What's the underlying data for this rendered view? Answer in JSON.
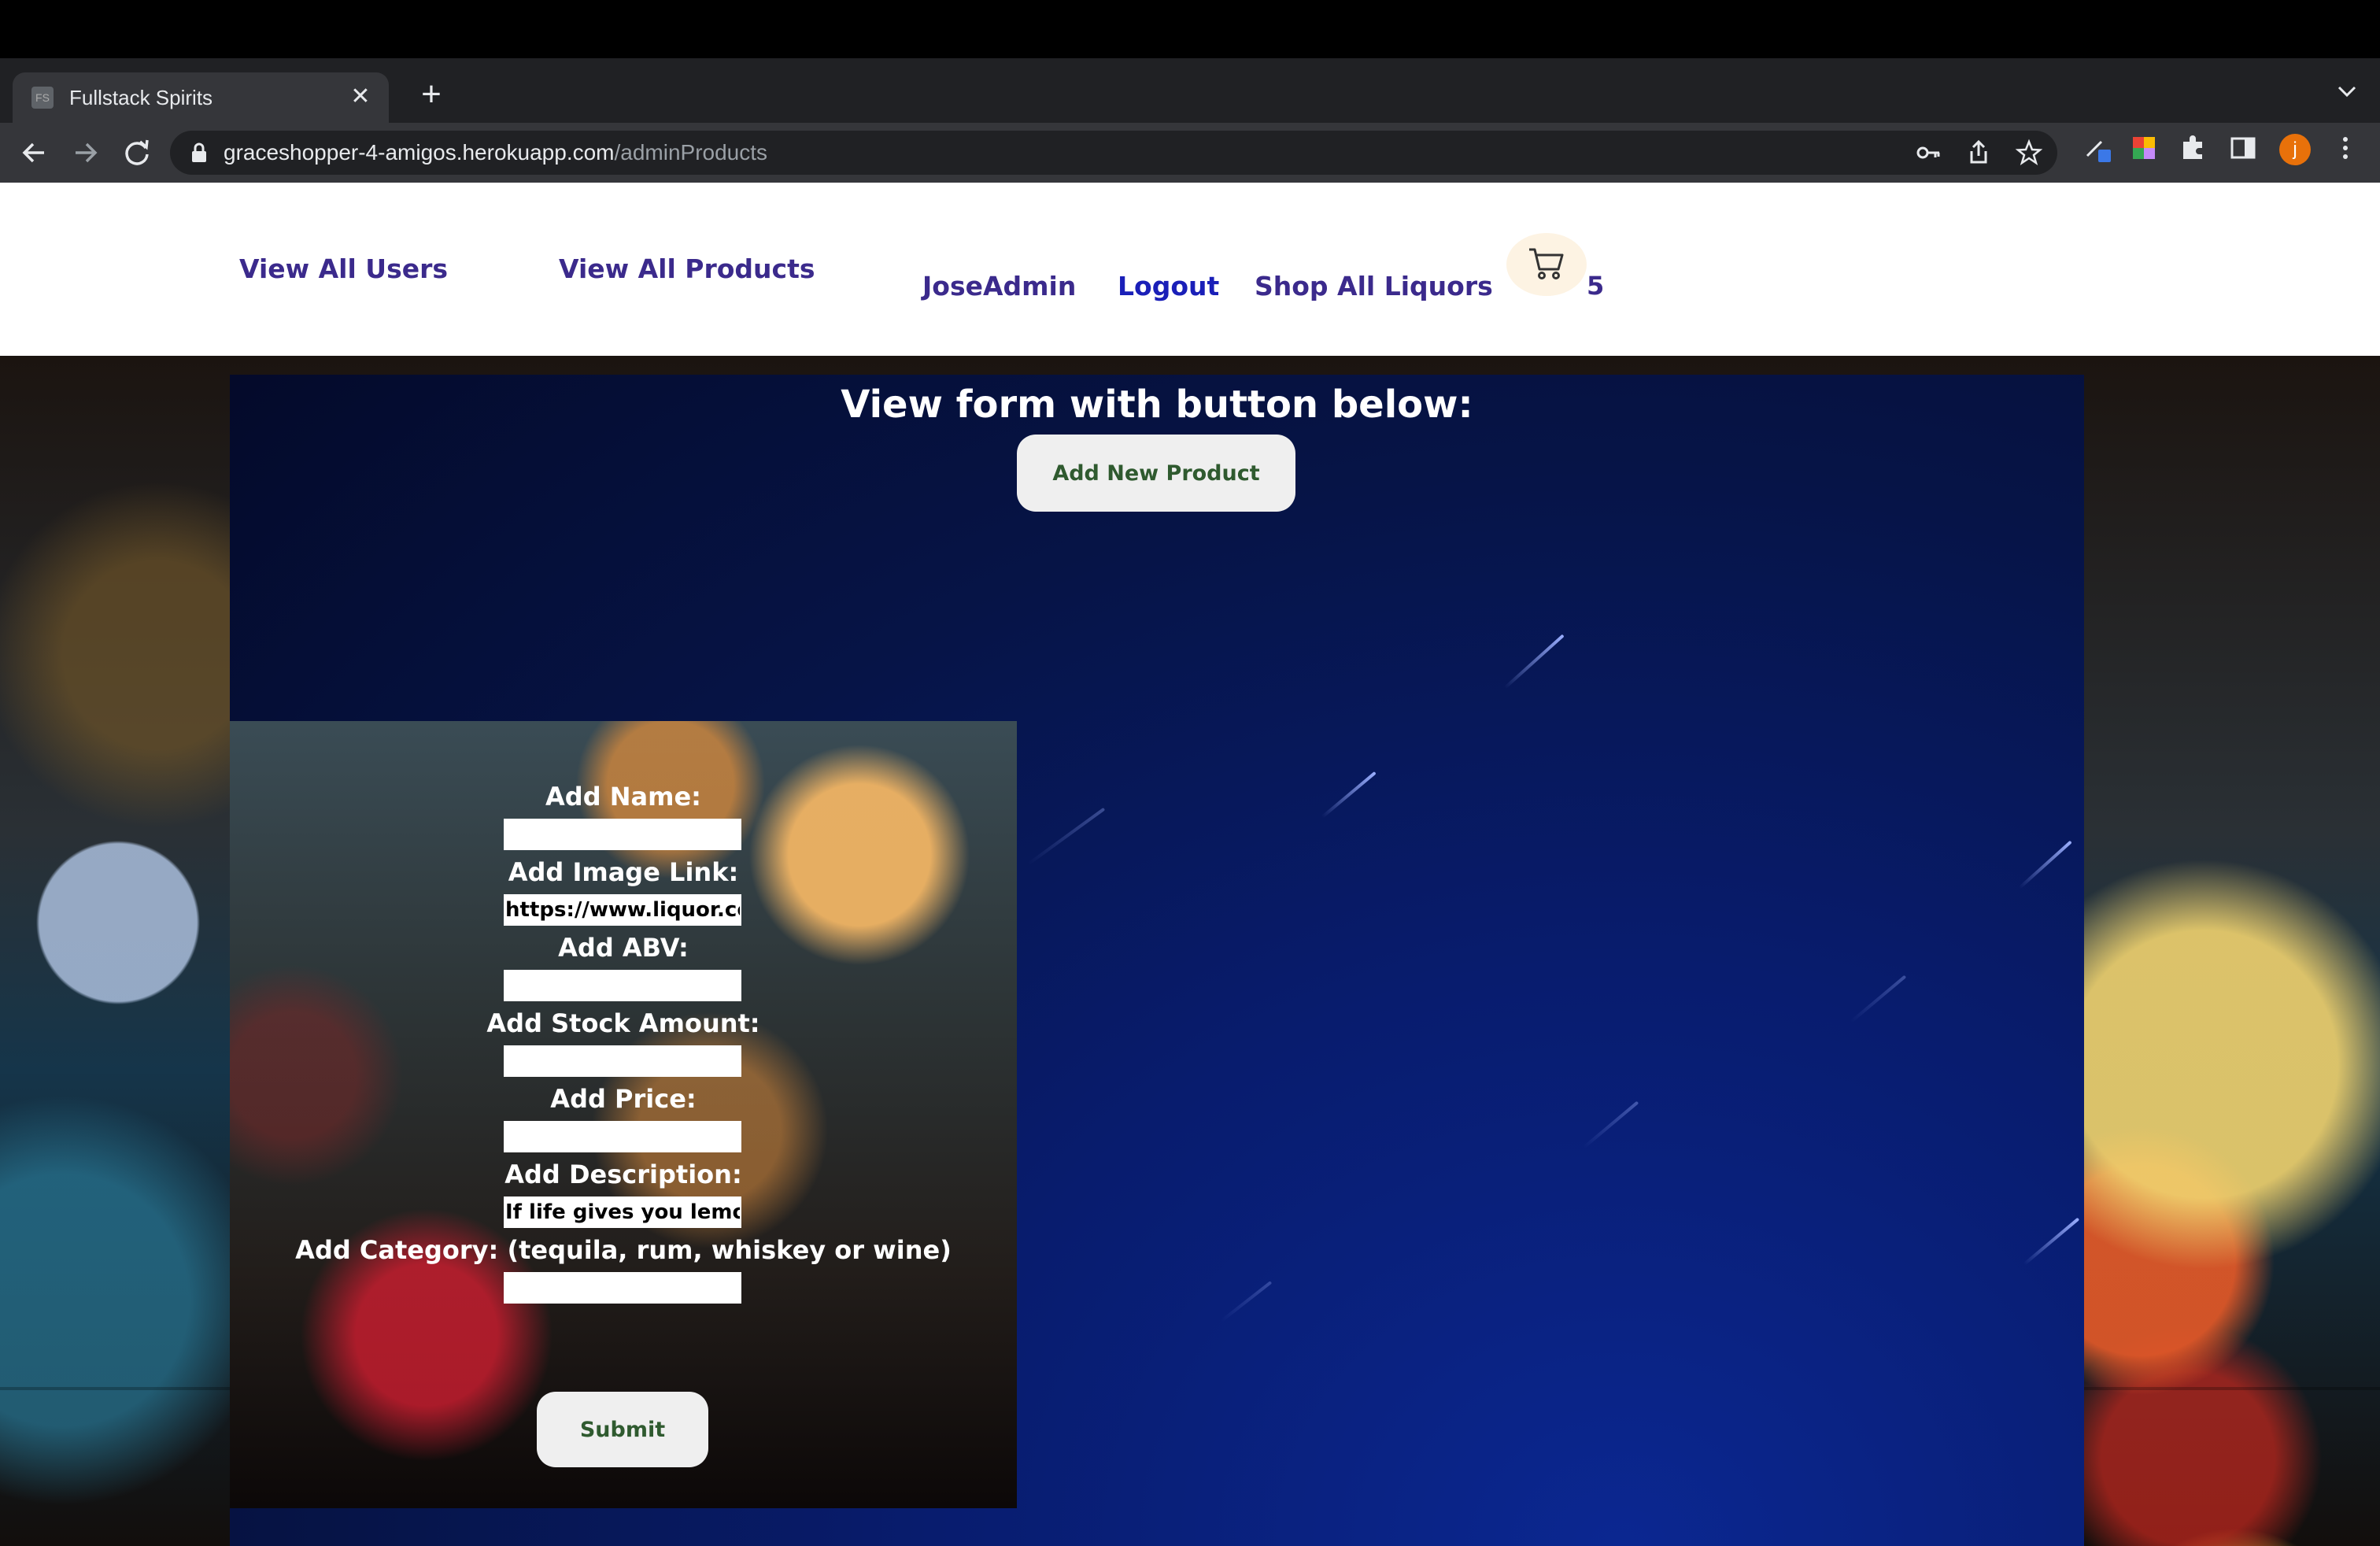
{
  "browser": {
    "tab_title": "Fullstack Spirits",
    "favicon_text": "FS",
    "tab_close": "✕",
    "new_tab": "+",
    "url_host": "graceshopper-4-amigos.herokuapp.com",
    "url_path": "/adminProducts",
    "avatar_initial": "j"
  },
  "nav": {
    "view_all_users": "View All Users",
    "view_all_products": "View All Products",
    "username": "JoseAdmin",
    "logout": "Logout",
    "shop_all": "Shop All Liquors",
    "cart_count": "5"
  },
  "main": {
    "heading": "View form with button below:",
    "add_product_button": "Add New Product"
  },
  "form": {
    "name_label": "Add Name:",
    "name_value": "",
    "image_label": "Add Image Link:",
    "image_value": "https://www.liquor.com",
    "abv_label": "Add ABV:",
    "abv_value": "",
    "stock_label": "Add Stock Amount:",
    "stock_value": "",
    "price_label": "Add Price:",
    "price_value": "",
    "description_label": "Add Description:",
    "description_value": "If life gives you lemons",
    "category_label": "Add Category: (tequila, rum, whiskey or wine)",
    "category_value": "",
    "submit_button": "Submit"
  },
  "colors": {
    "nav_link": "#3b2a8c",
    "logout_link": "#1a1fb8",
    "button_text": "#2f5a2f",
    "panel_blue": "#081c6e"
  }
}
